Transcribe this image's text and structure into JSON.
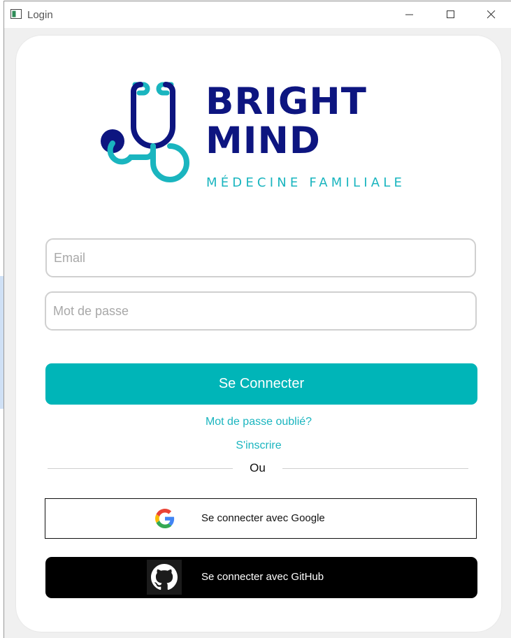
{
  "window": {
    "title": "Login",
    "controls": [
      "minimize",
      "maximize",
      "close"
    ]
  },
  "brand": {
    "line1": "BRIGHT",
    "line2": "MIND",
    "subtitle": "MÉDECINE FAMILIALE",
    "logo_icon": "stethoscope-icon",
    "colors": {
      "navy": "#0d1580",
      "teal": "#1ab5bf"
    }
  },
  "form": {
    "email_placeholder": "Email",
    "password_placeholder": "Mot de passe",
    "email_value": "",
    "password_value": "",
    "login_label": "Se Connecter",
    "forgot_label": "Mot de passe oublié?",
    "signup_label": "S'inscrire",
    "divider_label": "Ou"
  },
  "social": {
    "google_label": "Se connecter avec Google",
    "google_icon": "google-icon",
    "github_label": "Se connecter avec GitHub",
    "github_icon": "github-icon"
  },
  "colors": {
    "primary_button": "#00b5b8",
    "github_button": "#000000",
    "card_background": "#ffffff"
  }
}
